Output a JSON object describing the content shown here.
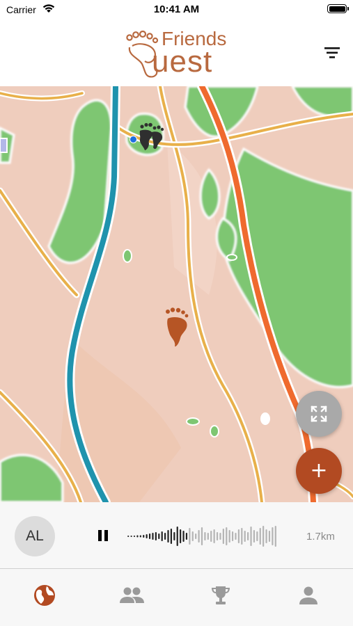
{
  "status_bar": {
    "carrier": "Carrier",
    "time": "10:41 AM",
    "icons": [
      "wifi-icon",
      "battery-icon"
    ]
  },
  "header": {
    "logo_line_1": "Friends",
    "logo_line_2": "uest",
    "logo_initial": "Q",
    "filter_icon": "filter-icon"
  },
  "map": {
    "markers": [
      "user-location",
      "friend-footprint-dark",
      "friend-footprint-orange"
    ],
    "expand_icon": "expand-icon",
    "add_icon": "plus-icon",
    "add_label": "+"
  },
  "player": {
    "avatar_initials": "AL",
    "state": "playing",
    "control_icon": "pause-icon",
    "distance": "1.7km"
  },
  "tabs": [
    {
      "name": "map",
      "icon": "globe-icon",
      "active": true
    },
    {
      "name": "friends",
      "icon": "people-icon",
      "active": false
    },
    {
      "name": "leaderboard",
      "icon": "trophy-icon",
      "active": false
    },
    {
      "name": "profile",
      "icon": "person-icon",
      "active": false
    }
  ],
  "colors": {
    "brand": "#b8693f",
    "accent": "#b24a22",
    "inactive_tab": "#9a9a9a",
    "user_dot": "#1e6fe0"
  }
}
